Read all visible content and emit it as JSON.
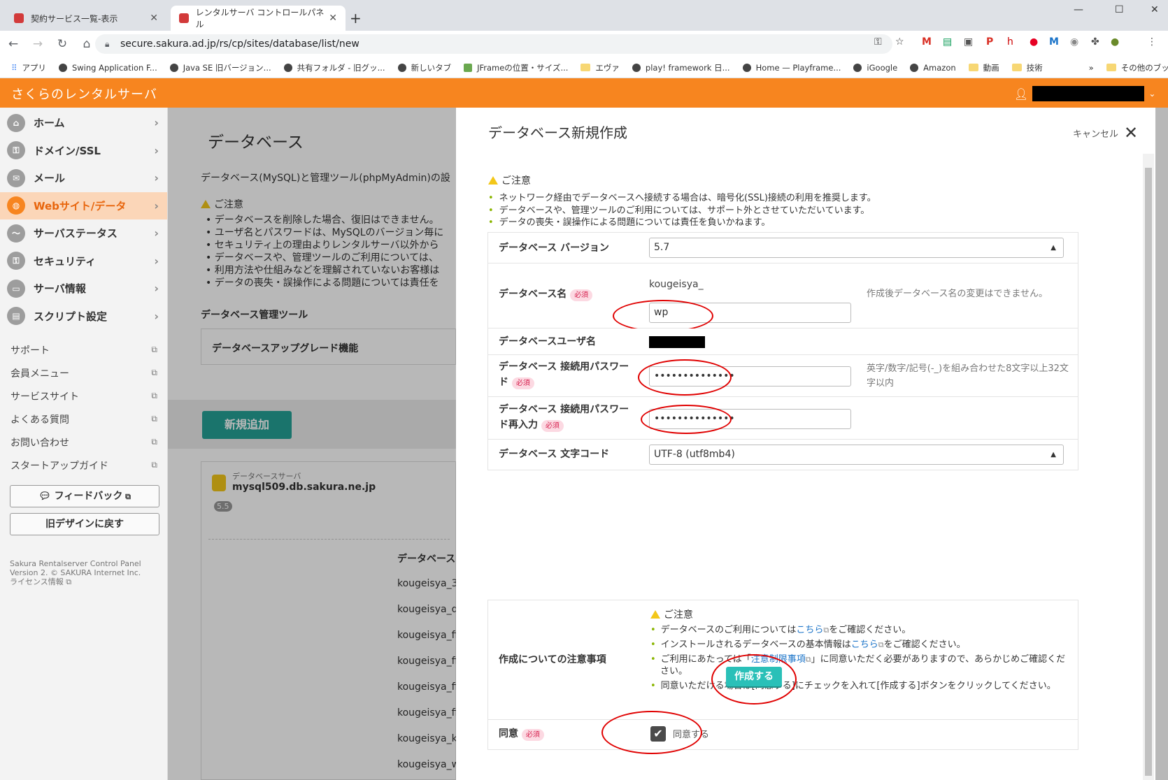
{
  "browser": {
    "tabs": [
      {
        "title": "契約サービス一覧-表示",
        "active": false
      },
      {
        "title": "レンタルサーバ コントロールパネル",
        "active": true
      }
    ],
    "new_tab": "+",
    "url": "secure.sakura.ad.jp/rs/cp/sites/database/list/new",
    "bookmarks": [
      "アプリ",
      "Swing Application F...",
      "Java SE 旧バージョン...",
      "共有フォルダ - 旧グッ...",
      "新しいタブ",
      "JFrameの位置・サイズ...",
      "エヴァ",
      "play! framework 日...",
      "Home — Playframe...",
      "iGoogle",
      "Amazon",
      "動画",
      "技術"
    ],
    "bookmarks_more": "»",
    "other_bookmarks": "その他のブックマーク"
  },
  "header": {
    "app_title": "さくらのレンタルサーバ"
  },
  "sidebar": {
    "items": [
      {
        "label": "ホーム",
        "icon": "home-icon",
        "active": false
      },
      {
        "label": "ドメイン/SSL",
        "icon": "lock-icon",
        "active": false
      },
      {
        "label": "メール",
        "icon": "mail-icon",
        "active": false
      },
      {
        "label": "Webサイト/データ",
        "icon": "globe-icon",
        "active": true
      },
      {
        "label": "サーバステータス",
        "icon": "chart-icon",
        "active": false
      },
      {
        "label": "セキュリティ",
        "icon": "lock-icon",
        "active": false
      },
      {
        "label": "サーバ情報",
        "icon": "server-icon",
        "active": false
      },
      {
        "label": "スクリプト設定",
        "icon": "script-icon",
        "active": false
      }
    ],
    "links": [
      "サポート",
      "会員メニュー",
      "サービスサイト",
      "よくある質問",
      "お問い合わせ",
      "スタートアップガイド"
    ],
    "feedback_button": "フィードバック",
    "old_design_button": "旧デザインに戻す",
    "footer_line1": "Sakura Rentalserver Control Panel",
    "footer_line2": "Version 2. © SAKURA Internet Inc.",
    "footer_line3": "ライセンス情報"
  },
  "background_page": {
    "title": "データベース",
    "intro": "データベース(MySQL)と管理ツール(phpMyAdmin)の設",
    "notice_heading": "ご注意",
    "notices": [
      "データベースを削除した場合、復旧はできません。",
      "ユーザ名とパスワードは、MySQLのバージョン毎に",
      "セキュリティ上の理由よりレンタルサーバ以外から",
      "データベースや、管理ツールのご利用については、",
      "利用方法や仕組みなどを理解されていないお客様は",
      "データの喪失・誤操作による問題については責任を"
    ],
    "tools_heading": "データベース管理ツール",
    "upgrade_label": "データベースアップグレード機能",
    "add_button": "新規追加",
    "server_caption": "データベースサーバ",
    "server_host": "mysql509.db.sakura.ne.jp",
    "server_version": "5.5",
    "db_column": "データベース",
    "db_rows": [
      "kougeisya_3",
      "kougeisya_d",
      "kougeisya_fi",
      "kougeisya_fi",
      "kougeisya_fi",
      "kougeisya_fi",
      "kougeisya_k",
      "kougeisya_w"
    ]
  },
  "panel": {
    "title": "データベース新規作成",
    "cancel": "キャンセル",
    "notice_heading": "ご注意",
    "notices": [
      "ネットワーク経由でデータベースへ接続する場合は、暗号化(SSL)接続の利用を推奨します。",
      "データベースや、管理ツールのご利用については、サポート外とさせていただいています。",
      "データの喪失・誤操作による問題については責任を負いかねます。"
    ],
    "required": "必須",
    "version_label": "データベース バージョン",
    "version_value": "5.7",
    "name_label": "データベース名",
    "name_prefix": "kougeisya_",
    "name_value": "wp",
    "name_hint": "作成後データベース名の変更はできません。",
    "user_label": "データベースユーザ名",
    "password_label": "データベース 接続用パスワード",
    "password_value": "••••••••••••••",
    "password_hint": "英字/数字/記号(-_)を組み合わせた8文字以上32文字以内",
    "password2_label": "データベース 接続用パスワード再入力",
    "password2_value": "••••••••••••••",
    "charset_label": "データベース 文字コード",
    "charset_value": "UTF-8 (utf8mb4)",
    "terms_label": "作成についての注意事項",
    "terms_heading": "ご注意",
    "terms": [
      {
        "pre": "データベースのご利用については",
        "link": "こちら",
        "post": "をご確認ください。"
      },
      {
        "pre": "インストールされるデータベースの基本情報は",
        "link": "こちら",
        "post": "をご確認ください。"
      },
      {
        "pre": "ご利用にあたっては「",
        "link": "注意制限事項",
        "post": "」に同意いただく必要がありますので、あらかじめご確認ください。"
      },
      {
        "pre": "同意いただける場合は[同意する]にチェックを入れて[作成する]ボタンをクリックしてください。",
        "link": "",
        "post": ""
      }
    ],
    "agree_label": "同意",
    "agree_checkbox": "同意する",
    "agree_checked": true,
    "create_button": "作成する"
  }
}
